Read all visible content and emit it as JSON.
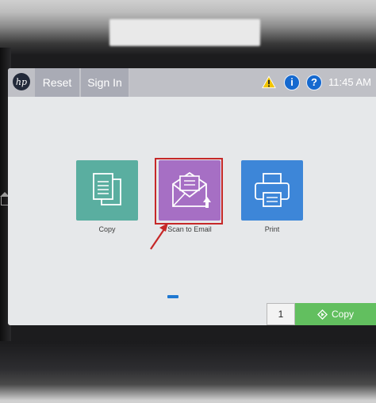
{
  "topbar": {
    "logo": "hp",
    "reset_label": "Reset",
    "signin_label": "Sign In",
    "time": "11:45 AM",
    "info_glyph": "i",
    "help_glyph": "?",
    "icons": [
      "hp-logo-icon",
      "warning-icon",
      "info-icon",
      "help-icon"
    ]
  },
  "apps": [
    {
      "label": "Copy",
      "icon": "copy-icon",
      "color": "#5aaea0"
    },
    {
      "label": "Scan to Email",
      "icon": "scan-to-email-icon",
      "color": "#a66fc4",
      "highlighted": true
    },
    {
      "label": "Print",
      "icon": "print-icon",
      "color": "#3d86d8"
    }
  ],
  "highlight_color": "#c62828",
  "page_indicator_color": "#1f78d1",
  "footer": {
    "copies": "1",
    "copy_button_label": "Copy",
    "copy_button_color": "#62bf5f"
  }
}
